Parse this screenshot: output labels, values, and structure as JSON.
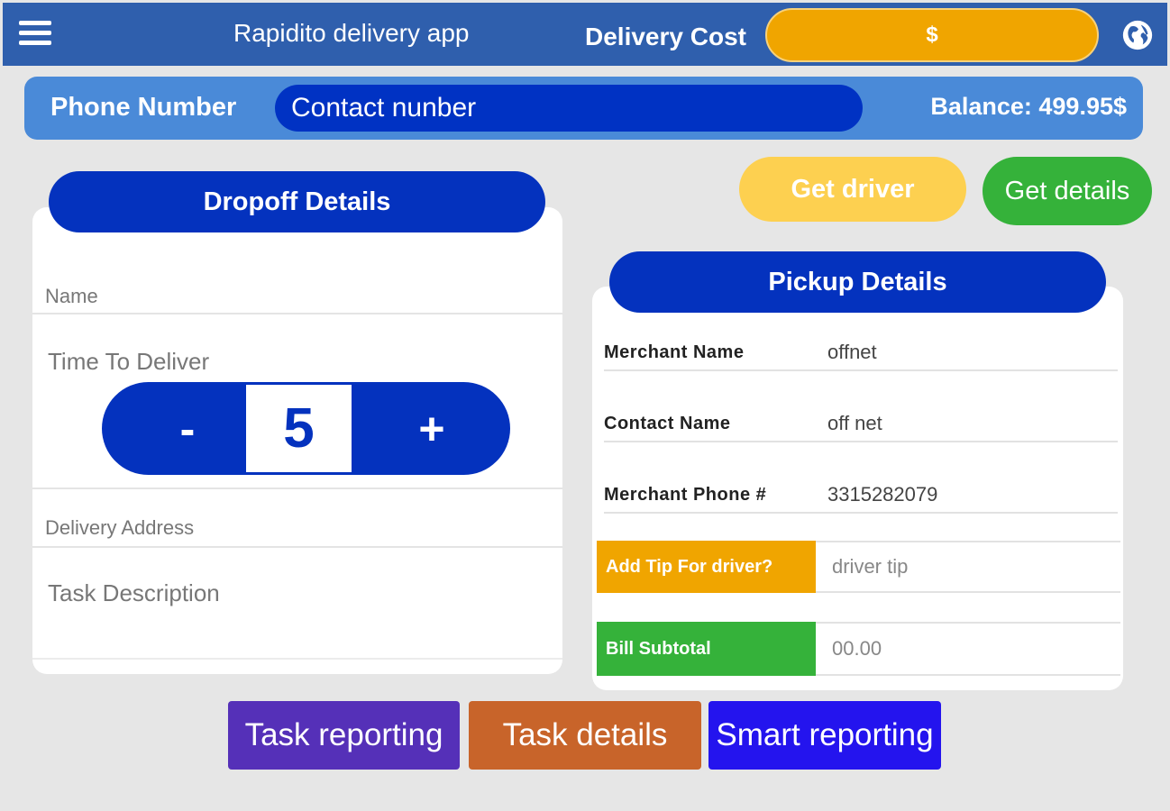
{
  "header": {
    "menu_icon": "hamburger-menu-icon",
    "title": "Rapidito delivery app",
    "cost_label": "Delivery Cost",
    "cost_value": "$",
    "globe_icon": "globe-icon",
    "colors": {
      "bar": "#2f5fad",
      "cost": "#f0a500"
    }
  },
  "phone": {
    "label": "Phone Number",
    "placeholder": "Contact nunber",
    "balance": "Balance: 499.95$"
  },
  "dropoff": {
    "title": "Dropoff Details",
    "name_placeholder": "Name",
    "time_label": "Time To Deliver",
    "minus": "-",
    "value": "5",
    "plus": "+",
    "address_placeholder": "Delivery Address",
    "task_placeholder": "Task Description"
  },
  "actions": {
    "get_driver": "Get driver",
    "get_details": "Get details"
  },
  "pickup": {
    "title": "Pickup Details",
    "rows": [
      {
        "label": "Merchant Name",
        "value": "offnet"
      },
      {
        "label": "Contact Name",
        "value": "off net"
      },
      {
        "label": "Merchant Phone #",
        "value": "3315282079"
      }
    ],
    "tip_label": "Add Tip For driver?",
    "tip_placeholder": "driver tip",
    "bill_label": "Bill Subtotal",
    "bill_placeholder": "00.00"
  },
  "footer": {
    "task_reporting": "Task reporting",
    "task_details": "Task details",
    "smart_reporting": "Smart reporting"
  }
}
